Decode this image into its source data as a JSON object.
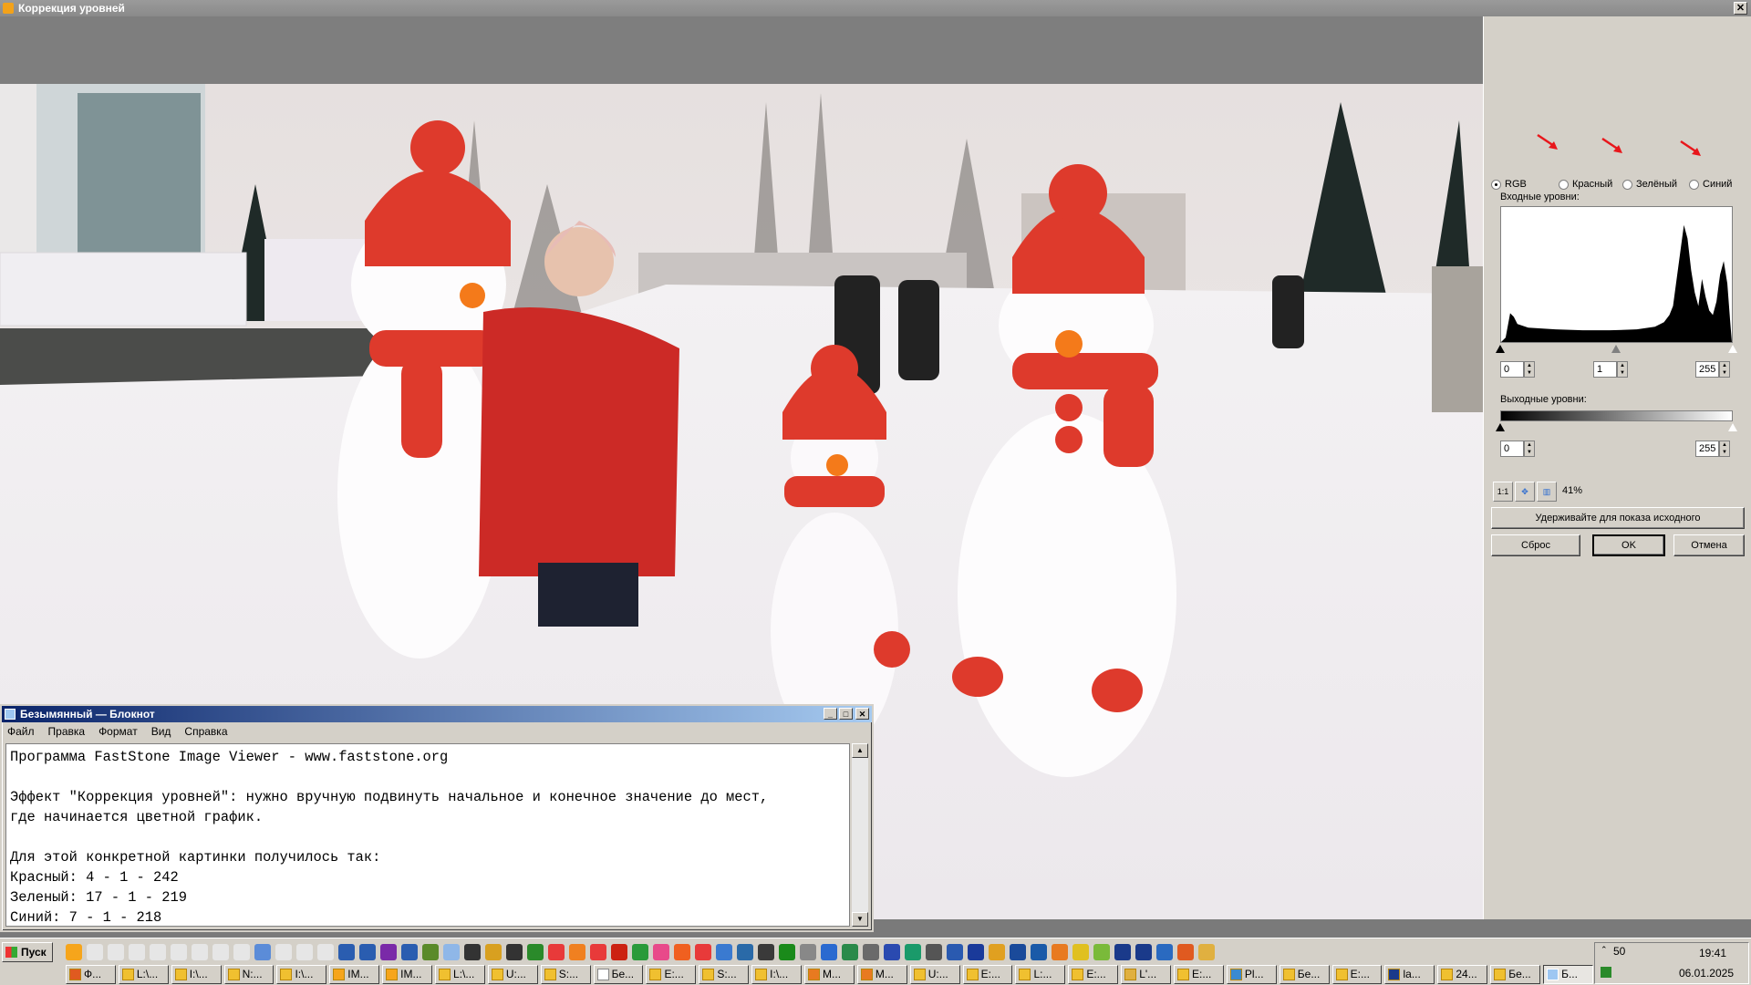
{
  "app": {
    "title": "Коррекция уровней"
  },
  "panel": {
    "channels": [
      {
        "label": "RGB",
        "checked": true
      },
      {
        "label": "Красный",
        "checked": false
      },
      {
        "label": "Зелёный",
        "checked": false
      },
      {
        "label": "Синий",
        "checked": false
      }
    ],
    "input_levels_label": "Входные уровни:",
    "input_black": "0",
    "input_gamma": "1",
    "input_white": "255",
    "output_levels_label": "Выходные уровни:",
    "output_black": "0",
    "output_white": "255",
    "zoom_buttons": [
      "1:1",
      "fit",
      "split"
    ],
    "zoom": "41%",
    "hold_button": "Удерживайте для показа исходного",
    "reset_button": "Сброс",
    "ok_button": "OK",
    "cancel_button": "Отмена",
    "annotation_arrow_color": "#e8161b"
  },
  "notepad": {
    "title": "Безымянный — Блокнот",
    "menu": [
      "Файл",
      "Правка",
      "Формат",
      "Вид",
      "Справка"
    ],
    "text": "Программа FastStone Image Viewer - www.faststone.org\n\nЭффект \"Коррекция уровней\": нужно вручную подвинуть начальное и конечное значение до мест,\nгде начинается цветной график.\n\nДля этой конкретной картинки получилось так:\nКрасный: 4 - 1 - 242\nЗеленый: 17 - 1 - 219\nСиний: 7 - 1 - 218"
  },
  "taskbar": {
    "start": "Пуск",
    "tasks": [
      "Ф...",
      "L:\\...",
      "I:\\...",
      "N:...",
      "I:\\...",
      "IM...",
      "IM...",
      "L:\\...",
      "U:...",
      "S:...",
      "Бе...",
      "E:...",
      "S:...",
      "I:\\...",
      "M...",
      "M...",
      "U:...",
      "E:...",
      "L:...",
      "E:...",
      "L'...",
      "E:...",
      "Pl...",
      "Бе...",
      "E:...",
      "la...",
      "24...",
      "Бе...",
      "Б..."
    ],
    "tray_number": "50",
    "time": "19:41",
    "date": "06.01.2025"
  }
}
